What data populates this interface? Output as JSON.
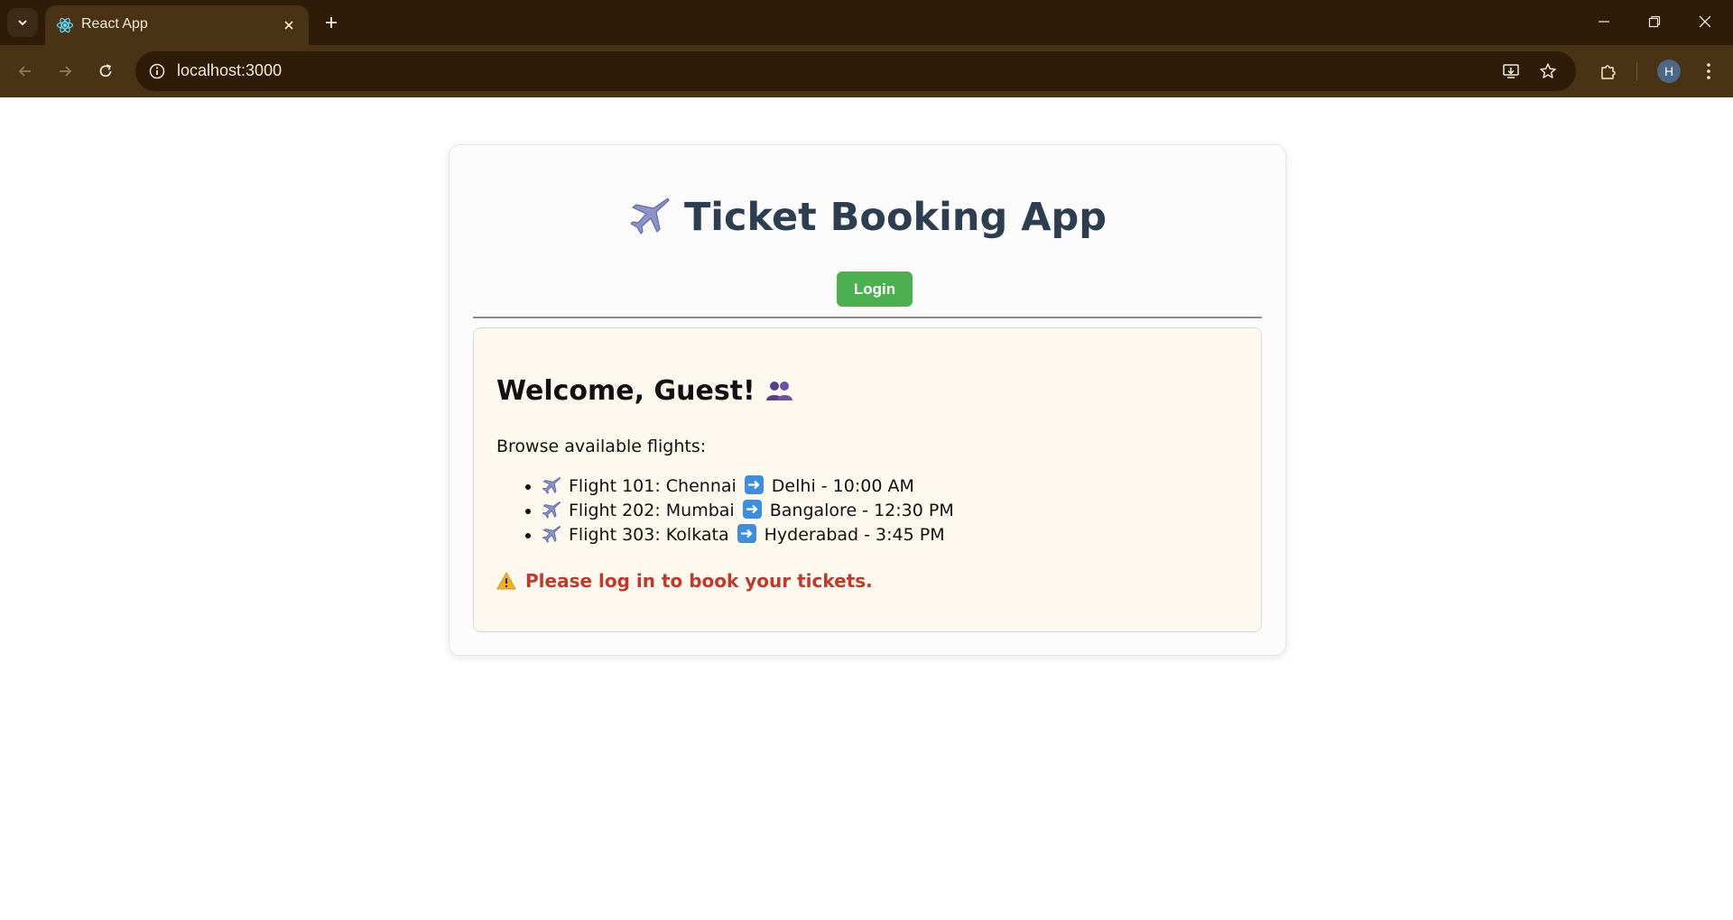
{
  "browser": {
    "tab_title": "React App",
    "url": "localhost:3000",
    "profile_initial": "H"
  },
  "app": {
    "title": "Ticket Booking App",
    "title_icon": "airplane-icon",
    "login_label": "Login",
    "welcome": "Welcome, Guest!",
    "welcome_icon": "people-icon",
    "browse_text": "Browse available flights:",
    "flights": [
      {
        "label": "Flight 101: Chennai",
        "destination": "Delhi - 10:00 AM"
      },
      {
        "label": "Flight 202: Mumbai",
        "destination": "Bangalore - 12:30 PM"
      },
      {
        "label": "Flight 303: Kolkata",
        "destination": "Hyderabad - 3:45 PM"
      }
    ],
    "warning": "Please log in to book your tickets.",
    "warning_icon": "warning-icon"
  },
  "colors": {
    "chrome_dark": "#2e1b08",
    "chrome_toolbar": "#4a3214",
    "login_button": "#4caf50",
    "title_text": "#2c3e50",
    "warning_text": "#c0392b",
    "panel_bg": "#fdf9ef"
  }
}
